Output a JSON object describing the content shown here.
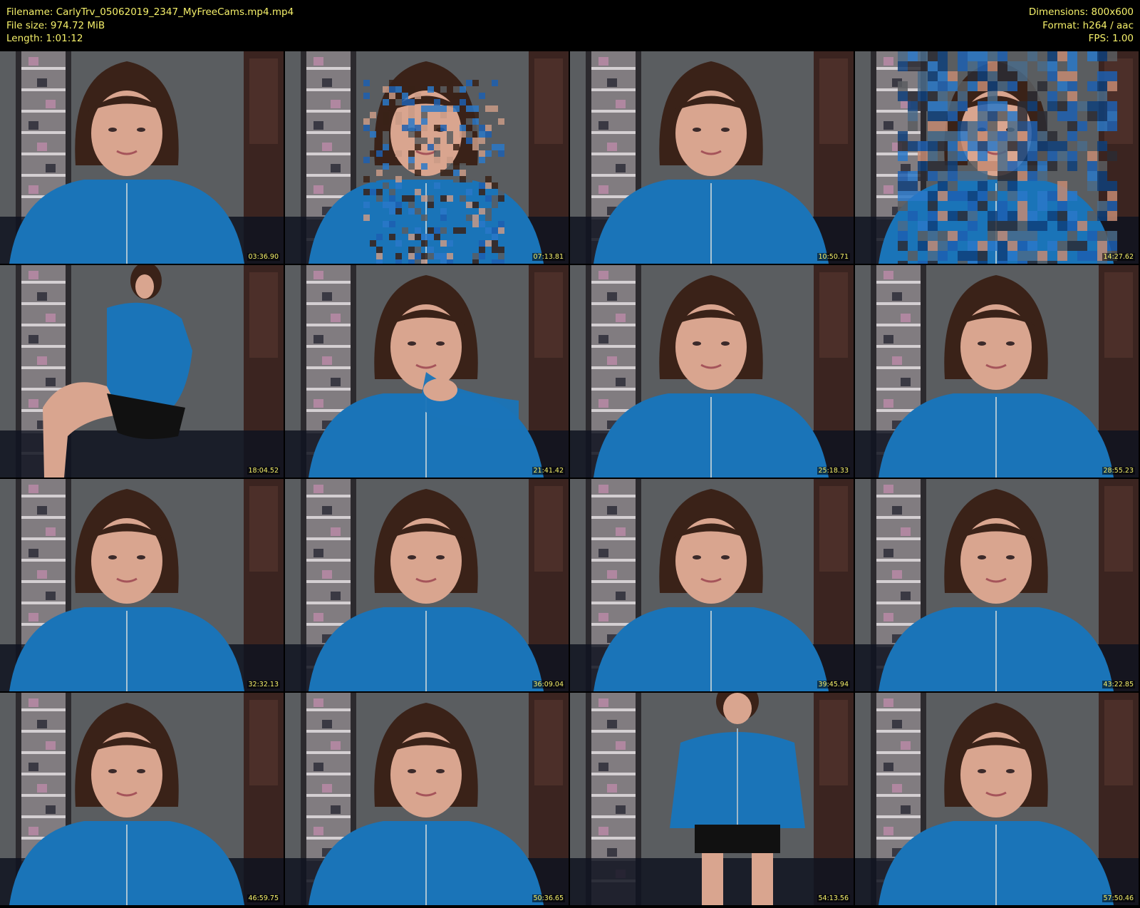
{
  "meta": {
    "filename_line": "Filename: CarlyTrv_05062019_2347_MyFreeCams.mp4.mp4",
    "filesize_line": "File size: 974.72 MiB",
    "length_line": "Length: 1:01:12",
    "dimensions_line": "Dimensions: 800x600",
    "format_line": "Format: h264 / aac",
    "fps_line": "FPS: 1.00",
    "text_color": "#f5f06a"
  },
  "thumbnails": [
    {
      "timestamp": "03:36.90",
      "pose": "seated-center",
      "distortion": "none"
    },
    {
      "timestamp": "07:13.81",
      "pose": "seated-center",
      "distortion": "pixelated"
    },
    {
      "timestamp": "10:50.71",
      "pose": "seated-center",
      "distortion": "none"
    },
    {
      "timestamp": "14:27.62",
      "pose": "seated-center",
      "distortion": "heavy-pixelated"
    },
    {
      "timestamp": "18:04.52",
      "pose": "kneeling-side",
      "distortion": "none"
    },
    {
      "timestamp": "21:41.42",
      "pose": "hand-on-chin",
      "distortion": "none"
    },
    {
      "timestamp": "25:18.33",
      "pose": "seated-center",
      "distortion": "none"
    },
    {
      "timestamp": "28:55.23",
      "pose": "seated-center",
      "distortion": "none"
    },
    {
      "timestamp": "32:32.13",
      "pose": "seated-center",
      "distortion": "none"
    },
    {
      "timestamp": "36:09.04",
      "pose": "seated-center",
      "distortion": "none"
    },
    {
      "timestamp": "39:45.94",
      "pose": "seated-center",
      "distortion": "none"
    },
    {
      "timestamp": "43:22.85",
      "pose": "seated-center",
      "distortion": "none"
    },
    {
      "timestamp": "46:59.75",
      "pose": "seated-center",
      "distortion": "none"
    },
    {
      "timestamp": "50:36.65",
      "pose": "seated-center",
      "distortion": "none"
    },
    {
      "timestamp": "54:13.56",
      "pose": "standing",
      "distortion": "none"
    },
    {
      "timestamp": "57:50.46",
      "pose": "seated-center",
      "distortion": "none"
    }
  ],
  "colors": {
    "background_wall": "#5a5d60",
    "hoodie": "#1a74b8",
    "hair": "#3a2218",
    "skin": "#d9a58f",
    "shelf": "#c8bfc4",
    "door": "#3b2420",
    "couch": "#0f1320"
  }
}
